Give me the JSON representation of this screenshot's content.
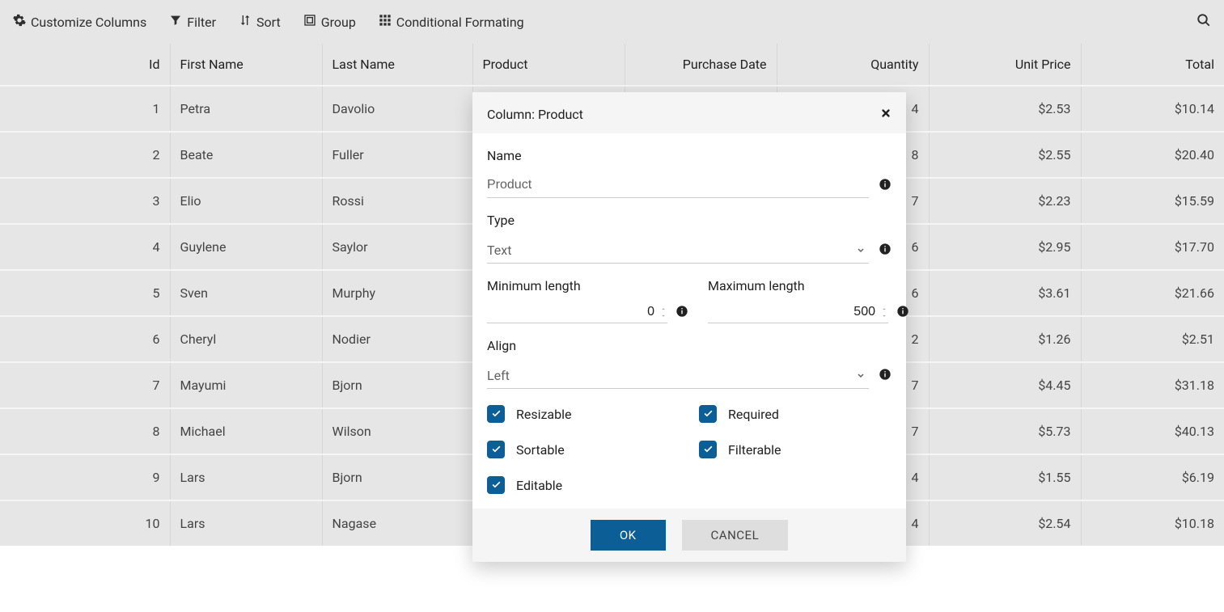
{
  "toolbar": {
    "customize": "Customize Columns",
    "filter": "Filter",
    "sort": "Sort",
    "group": "Group",
    "conditional": "Conditional Formating"
  },
  "columns": {
    "id": "Id",
    "first_name": "First Name",
    "last_name": "Last Name",
    "product": "Product",
    "purchase_date": "Purchase Date",
    "quantity": "Quantity",
    "unit_price": "Unit Price",
    "total": "Total"
  },
  "rows": [
    {
      "id": "1",
      "fn": "Petra",
      "ln": "Davolio",
      "prod": "",
      "date": "",
      "qty": "4",
      "price": "$2.53",
      "total": "$10.14"
    },
    {
      "id": "2",
      "fn": "Beate",
      "ln": "Fuller",
      "prod": "",
      "date": "",
      "qty": "8",
      "price": "$2.55",
      "total": "$20.40"
    },
    {
      "id": "3",
      "fn": "Elio",
      "ln": "Rossi",
      "prod": "",
      "date": "",
      "qty": "7",
      "price": "$2.23",
      "total": "$15.59"
    },
    {
      "id": "4",
      "fn": "Guylene",
      "ln": "Saylor",
      "prod": "",
      "date": "",
      "qty": "6",
      "price": "$2.95",
      "total": "$17.70"
    },
    {
      "id": "5",
      "fn": "Sven",
      "ln": "Murphy",
      "prod": "",
      "date": "",
      "qty": "6",
      "price": "$3.61",
      "total": "$21.66"
    },
    {
      "id": "6",
      "fn": "Cheryl",
      "ln": "Nodier",
      "prod": "",
      "date": "",
      "qty": "2",
      "price": "$1.26",
      "total": "$2.51"
    },
    {
      "id": "7",
      "fn": "Mayumi",
      "ln": "Bjorn",
      "prod": "",
      "date": "",
      "qty": "7",
      "price": "$4.45",
      "total": "$31.18"
    },
    {
      "id": "8",
      "fn": "Michael",
      "ln": "Wilson",
      "prod": "",
      "date": "",
      "qty": "7",
      "price": "$5.73",
      "total": "$40.13"
    },
    {
      "id": "9",
      "fn": "Lars",
      "ln": "Bjorn",
      "prod": "",
      "date": "",
      "qty": "4",
      "price": "$1.55",
      "total": "$6.19"
    },
    {
      "id": "10",
      "fn": "Lars",
      "ln": "Nagase",
      "prod": "",
      "date": "",
      "qty": "4",
      "price": "$2.54",
      "total": "$10.18"
    }
  ],
  "popup": {
    "title": "Column: Product",
    "name_label": "Name",
    "name_value": "Product",
    "type_label": "Type",
    "type_value": "Text",
    "min_label": "Minimum length",
    "min_value": "0",
    "max_label": "Maximum length",
    "max_value": "500",
    "align_label": "Align",
    "align_value": "Left",
    "cb_resizable": "Resizable",
    "cb_required": "Required",
    "cb_sortable": "Sortable",
    "cb_filterable": "Filterable",
    "cb_editable": "Editable",
    "ok": "OK",
    "cancel": "CANCEL"
  }
}
